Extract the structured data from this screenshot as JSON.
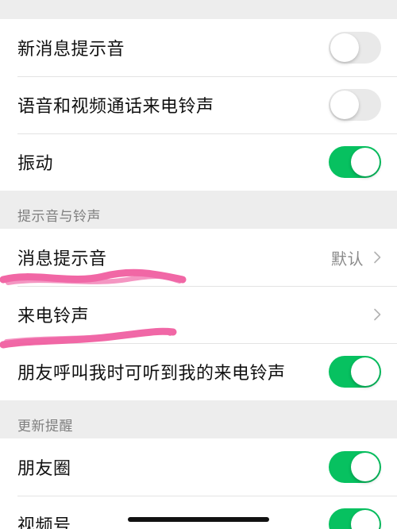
{
  "groups": [
    {
      "header": null,
      "rows": [
        {
          "label": "新消息提示音",
          "type": "toggle",
          "on": false
        },
        {
          "label": "语音和视频通话来电铃声",
          "type": "toggle",
          "on": false
        },
        {
          "label": "振动",
          "type": "toggle",
          "on": true
        }
      ]
    },
    {
      "header": "提示音与铃声",
      "rows": [
        {
          "label": "消息提示音",
          "type": "link",
          "value": "默认"
        },
        {
          "label": "来电铃声",
          "type": "link",
          "value": ""
        },
        {
          "label": "朋友呼叫我时可听到我的来电铃声",
          "type": "toggle",
          "on": true
        }
      ]
    },
    {
      "header": "更新提醒",
      "rows": [
        {
          "label": "朋友圈",
          "type": "toggle",
          "on": true
        },
        {
          "label": "视频号",
          "type": "toggle",
          "on": true
        }
      ]
    }
  ],
  "colors": {
    "toggle_on": "#07c160",
    "toggle_off": "#e9e9e9",
    "annotation_scribble": "#f0569b"
  },
  "annotations": [
    "pink-scribble-under-message-tone",
    "pink-scribble-under-call-ringtone"
  ]
}
